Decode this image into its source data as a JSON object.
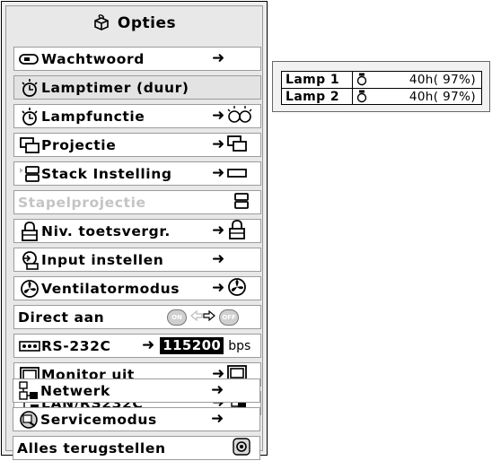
{
  "menu": {
    "title": "Opties",
    "items": [
      {
        "label": "Wachtwoord",
        "icon": "key-icon",
        "value_icon": ""
      },
      {
        "label": "Lamptimer (duur)",
        "icon": "lamp-timer-icon",
        "selected": true
      },
      {
        "label": "Lampfunctie",
        "icon": "lamp-timer-icon",
        "value_icon": "lamp-mode-icon"
      },
      {
        "label": "Projectie",
        "icon": "projection-icon",
        "value_icon": "projection-icon"
      },
      {
        "label": "Stack Instelling",
        "icon": "stack-icon",
        "value_icon": "stack-bar-icon"
      },
      {
        "label": "Stapelprojectie",
        "icon": "",
        "value_icon": "stack-icon",
        "disabled": true
      },
      {
        "label": "Niv. toetsvergr.",
        "icon": "padlock-icon",
        "value_icon": "padlock-icon"
      },
      {
        "label": "Input instellen",
        "icon": "input-icon",
        "value_icon": ""
      },
      {
        "label": "Ventilatormodus",
        "icon": "fan-icon",
        "value_icon": "fan-icon"
      },
      {
        "label": "Direct aan",
        "icon": "",
        "value_on": "ON",
        "value_off": "OFF"
      },
      {
        "label": "RS-232C",
        "icon": "rs232-icon",
        "value": "115200",
        "unit": "bps"
      },
      {
        "label": "Monitor uit",
        "icon": "monitor-icon",
        "value_icon": "monitor-icon"
      },
      {
        "label": "LAN/RS232C",
        "icon": "lan-icon",
        "value_icon": "lan-icon"
      },
      {
        "label": "Netwerk",
        "icon": "network-icon",
        "value_icon": ""
      },
      {
        "label": "Servicemodus",
        "icon": "service-icon",
        "value_icon": ""
      },
      {
        "label": "Alles terugstellen",
        "icon": "",
        "value_icon": "reset-icon"
      }
    ],
    "arrow": "➜"
  },
  "lamp_table": {
    "rows": [
      {
        "label": "Lamp 1",
        "value": "40h( 97%)"
      },
      {
        "label": "Lamp 2",
        "value": "40h( 97%)"
      }
    ]
  }
}
